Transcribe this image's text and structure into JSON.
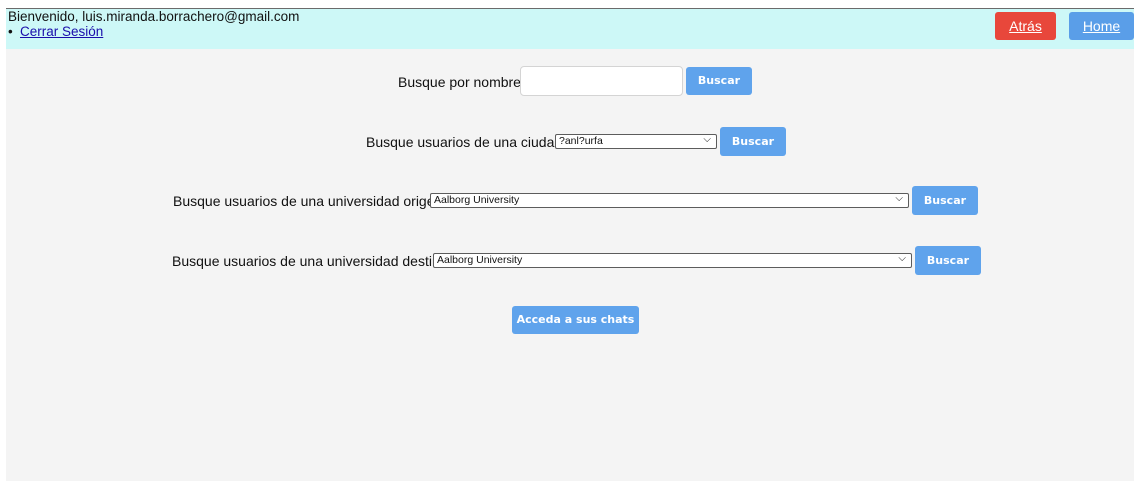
{
  "header": {
    "welcome_text": "Bienvenido, luis.miranda.borrachero@gmail.com",
    "logout_bullet": "•",
    "logout_label": "Cerrar Sesión",
    "back_label": "Atrás",
    "home_label": "Home",
    "colors": {
      "bar_background": "#cdf8f7",
      "back_button": "#e8473b",
      "home_button": "#5a9ee8"
    }
  },
  "search_by_name": {
    "label": "Busque por nombre:",
    "value": "",
    "button_label": "Buscar"
  },
  "search_by_city": {
    "label": "Busque usuarios de una ciudad:",
    "selected": "?anl?urfa",
    "button_label": "Buscar"
  },
  "search_by_origin_university": {
    "label": "Busque usuarios de una universidad origen:",
    "selected": "Aalborg University",
    "button_label": "Buscar"
  },
  "search_by_destination_university": {
    "label": "Busque usuarios de una universidad destino:",
    "selected": "Aalborg University",
    "button_label": "Buscar"
  },
  "chats": {
    "button_label": "Acceda a sus chats"
  },
  "colors": {
    "primary_button": "#5fa3ec",
    "page_background": "#f4f4f4"
  }
}
